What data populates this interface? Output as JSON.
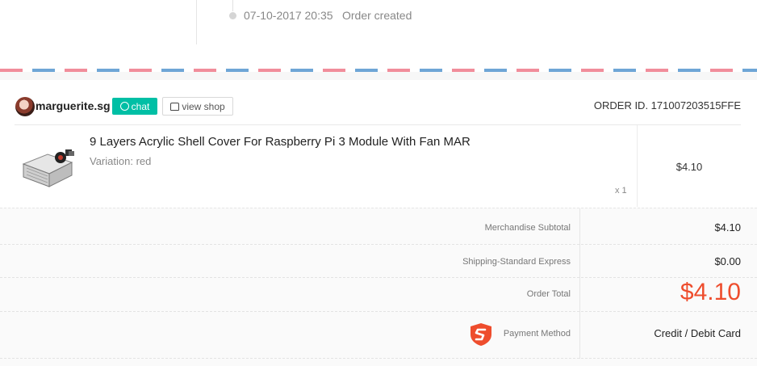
{
  "timeline": {
    "timestamp": "07-10-2017 20:35",
    "event": "Order created"
  },
  "shop": {
    "name": "marguerite.sg",
    "chat_label": "chat",
    "view_shop_label": "view shop",
    "order_id": "ORDER ID. 171007203515FFE"
  },
  "item": {
    "title": "9 Layers Acrylic Shell Cover For Raspberry Pi 3 Module With Fan MAR",
    "variation": "Variation: red",
    "quantity": "x 1",
    "price": "$4.10"
  },
  "totals": {
    "subtotal_label": "Merchandise Subtotal",
    "subtotal_value": "$4.10",
    "shipping_label": "Shipping-Standard Express",
    "shipping_value": "$0.00",
    "order_total_label": "Order Total",
    "order_total_value": "$4.10",
    "payment_label": "Payment Method",
    "payment_value": "Credit / Debit Card"
  },
  "colors": {
    "accent": "#ee4d2d",
    "chat": "#00bfa5",
    "airmail_red": "#f18d9b",
    "airmail_blue": "#6fa6d6"
  }
}
